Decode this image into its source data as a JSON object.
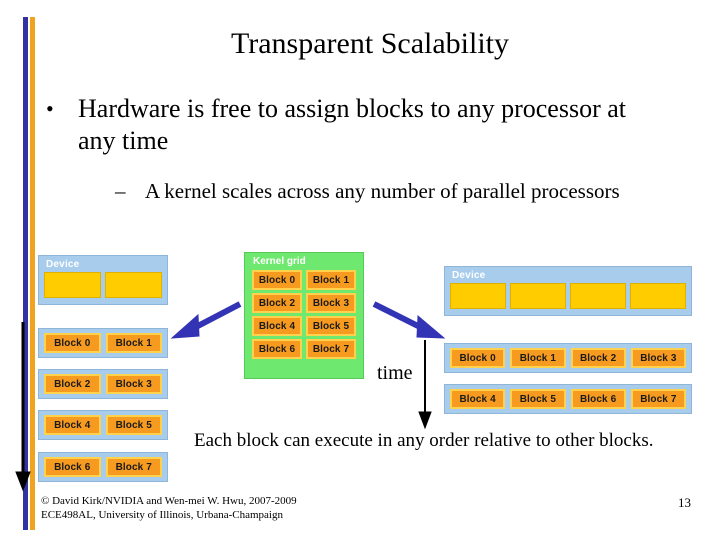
{
  "slide": {
    "title": "Transparent Scalability",
    "page_number": "13",
    "accent_blue": "#3232A0",
    "accent_orange": "#F0A31E"
  },
  "bullets": [
    {
      "marker": "•",
      "text": "Hardware is free to assign blocks to any processor at any time"
    },
    {
      "marker": "–",
      "text": "A kernel scales across any number of parallel processors"
    }
  ],
  "diagram": {
    "kernel_grid": {
      "label": "Kernel grid",
      "background": "#6FE86F",
      "block_color": "#F79B20",
      "rows": [
        [
          "Block 0",
          "Block 1"
        ],
        [
          "Block 2",
          "Block 3"
        ],
        [
          "Block 4",
          "Block 5"
        ],
        [
          "Block 6",
          "Block 7"
        ]
      ]
    },
    "device_left": {
      "label": "Device",
      "background": "#A8CCEC",
      "cell_color": "#FFCC00",
      "cell_count": 2,
      "rows": [
        [
          "Block 0",
          "Block 1"
        ],
        [
          "Block 2",
          "Block 3"
        ],
        [
          "Block 4",
          "Block 5"
        ],
        [
          "Block 6",
          "Block 7"
        ]
      ]
    },
    "device_right": {
      "label": "Device",
      "background": "#A8CCEC",
      "cell_color": "#FFCC00",
      "cell_count": 4,
      "rows": [
        [
          "Block 0",
          "Block 1",
          "Block 2",
          "Block 3"
        ],
        [
          "Block 4",
          "Block 5",
          "Block 6",
          "Block 7"
        ]
      ]
    },
    "time_label": "time",
    "arrow_color": "#3333B5"
  },
  "note": "Each block can execute in any order relative to other blocks.",
  "footer": {
    "line1": "© David Kirk/NVIDIA and Wen-mei W. Hwu, 2007-2009",
    "line2": "ECE498AL, University of Illinois, Urbana-Champaign"
  }
}
